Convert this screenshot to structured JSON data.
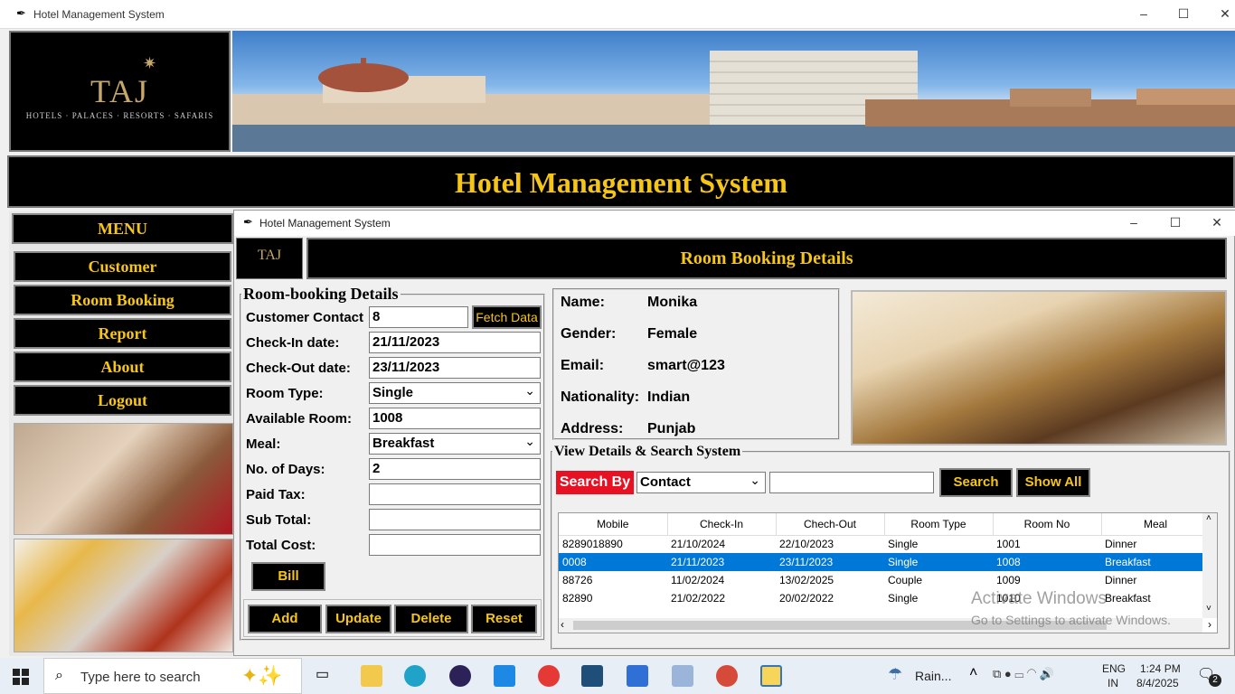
{
  "outer_window": {
    "title": "Hotel Management System"
  },
  "logo": {
    "brand": "TAJ",
    "tagline": "HOTELS · PALACES · RESORTS · SAFARIS"
  },
  "main_header": {
    "title": "Hotel Management System"
  },
  "menu": {
    "title": "MENU",
    "items": [
      "Customer",
      "Room Booking",
      "Report",
      "About",
      "Logout"
    ]
  },
  "inner_window": {
    "title": "Hotel Management System"
  },
  "inner_header": {
    "title": "Room Booking Details"
  },
  "booking_form": {
    "legend": "Room-booking Details",
    "fields": [
      {
        "label": "Customer Contact",
        "value": "8"
      },
      {
        "label": "Check-In date:",
        "value": "21/11/2023"
      },
      {
        "label": "Check-Out date:",
        "value": "23/11/2023"
      },
      {
        "label": "Room Type:",
        "value": "Single"
      },
      {
        "label": "Available Room:",
        "value": "1008"
      },
      {
        "label": "Meal:",
        "value": "Breakfast"
      },
      {
        "label": "No. of Days:",
        "value": "2"
      },
      {
        "label": "Paid Tax:",
        "value": ""
      },
      {
        "label": "Sub Total:",
        "value": ""
      },
      {
        "label": "Total Cost:",
        "value": ""
      }
    ],
    "fetch_label": "Fetch Data",
    "bill_label": "Bill",
    "buttons": [
      "Add",
      "Update",
      "Delete",
      "Reset"
    ]
  },
  "customer_details": {
    "rows": [
      {
        "label": "Name:",
        "value": "Monika"
      },
      {
        "label": "Gender:",
        "value": "Female"
      },
      {
        "label": "Email:",
        "value": "smart@123"
      },
      {
        "label": "Nationality:",
        "value": "Indian"
      },
      {
        "label": "Address:",
        "value": "Punjab"
      }
    ]
  },
  "search": {
    "legend": "View Details & Search System",
    "search_by_label": "Search By",
    "search_by_value": "Contact",
    "search_text": "",
    "search_button": "Search",
    "show_all_button": "Show All"
  },
  "table": {
    "columns": [
      "Mobile",
      "Check-In",
      "Chech-Out",
      "Room Type",
      "Room No",
      "Meal"
    ],
    "rows": [
      [
        "8289018890",
        "21/10/2024",
        "22/10/2023",
        "Single",
        "1001",
        "Dinner"
      ],
      [
        "0008",
        "21/11/2023",
        "23/11/2023",
        "Single",
        "1008",
        "Breakfast"
      ],
      [
        "88726",
        "11/02/2024",
        "13/02/2025",
        "Couple",
        "1009",
        "Dinner"
      ],
      [
        "82890",
        "21/02/2022",
        "20/02/2022",
        "Single",
        "1010",
        "Breakfast"
      ]
    ],
    "selected_row": 1
  },
  "watermark": {
    "line1": "Activate Windows",
    "line2": "Go to Settings to activate Windows."
  },
  "taskbar": {
    "search_placeholder": "Type here to search",
    "weather": "Rain...",
    "lang1": "ENG",
    "lang2": "IN",
    "time": "1:24 PM",
    "date": "8/4/2025",
    "notif_count": "2"
  },
  "colors": {
    "accent_gold": "#f5c518",
    "search_by_red": "#e81123",
    "selection_blue": "#0078d7"
  }
}
